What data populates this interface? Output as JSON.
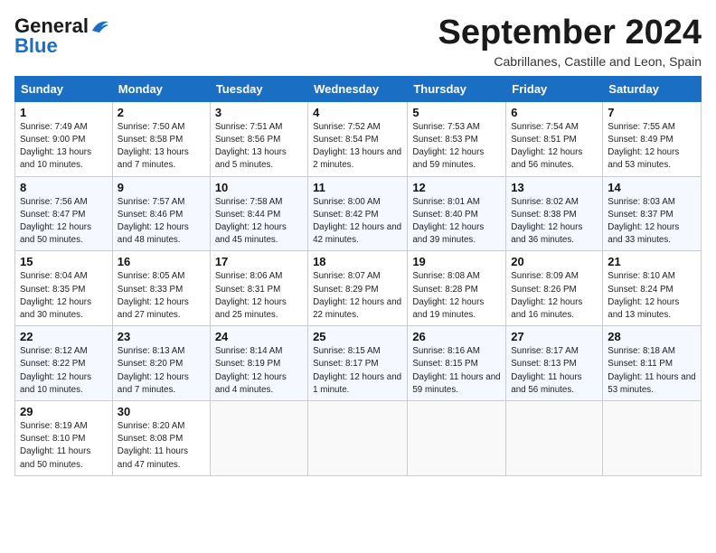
{
  "header": {
    "logo_general": "General",
    "logo_blue": "Blue",
    "month_title": "September 2024",
    "location": "Cabrillanes, Castille and Leon, Spain"
  },
  "weekdays": [
    "Sunday",
    "Monday",
    "Tuesday",
    "Wednesday",
    "Thursday",
    "Friday",
    "Saturday"
  ],
  "weeks": [
    [
      {
        "day": "1",
        "sunrise": "7:49 AM",
        "sunset": "9:00 PM",
        "daylight": "13 hours and 10 minutes."
      },
      {
        "day": "2",
        "sunrise": "7:50 AM",
        "sunset": "8:58 PM",
        "daylight": "13 hours and 7 minutes."
      },
      {
        "day": "3",
        "sunrise": "7:51 AM",
        "sunset": "8:56 PM",
        "daylight": "13 hours and 5 minutes."
      },
      {
        "day": "4",
        "sunrise": "7:52 AM",
        "sunset": "8:54 PM",
        "daylight": "13 hours and 2 minutes."
      },
      {
        "day": "5",
        "sunrise": "7:53 AM",
        "sunset": "8:53 PM",
        "daylight": "12 hours and 59 minutes."
      },
      {
        "day": "6",
        "sunrise": "7:54 AM",
        "sunset": "8:51 PM",
        "daylight": "12 hours and 56 minutes."
      },
      {
        "day": "7",
        "sunrise": "7:55 AM",
        "sunset": "8:49 PM",
        "daylight": "12 hours and 53 minutes."
      }
    ],
    [
      {
        "day": "8",
        "sunrise": "7:56 AM",
        "sunset": "8:47 PM",
        "daylight": "12 hours and 50 minutes."
      },
      {
        "day": "9",
        "sunrise": "7:57 AM",
        "sunset": "8:46 PM",
        "daylight": "12 hours and 48 minutes."
      },
      {
        "day": "10",
        "sunrise": "7:58 AM",
        "sunset": "8:44 PM",
        "daylight": "12 hours and 45 minutes."
      },
      {
        "day": "11",
        "sunrise": "8:00 AM",
        "sunset": "8:42 PM",
        "daylight": "12 hours and 42 minutes."
      },
      {
        "day": "12",
        "sunrise": "8:01 AM",
        "sunset": "8:40 PM",
        "daylight": "12 hours and 39 minutes."
      },
      {
        "day": "13",
        "sunrise": "8:02 AM",
        "sunset": "8:38 PM",
        "daylight": "12 hours and 36 minutes."
      },
      {
        "day": "14",
        "sunrise": "8:03 AM",
        "sunset": "8:37 PM",
        "daylight": "12 hours and 33 minutes."
      }
    ],
    [
      {
        "day": "15",
        "sunrise": "8:04 AM",
        "sunset": "8:35 PM",
        "daylight": "12 hours and 30 minutes."
      },
      {
        "day": "16",
        "sunrise": "8:05 AM",
        "sunset": "8:33 PM",
        "daylight": "12 hours and 27 minutes."
      },
      {
        "day": "17",
        "sunrise": "8:06 AM",
        "sunset": "8:31 PM",
        "daylight": "12 hours and 25 minutes."
      },
      {
        "day": "18",
        "sunrise": "8:07 AM",
        "sunset": "8:29 PM",
        "daylight": "12 hours and 22 minutes."
      },
      {
        "day": "19",
        "sunrise": "8:08 AM",
        "sunset": "8:28 PM",
        "daylight": "12 hours and 19 minutes."
      },
      {
        "day": "20",
        "sunrise": "8:09 AM",
        "sunset": "8:26 PM",
        "daylight": "12 hours and 16 minutes."
      },
      {
        "day": "21",
        "sunrise": "8:10 AM",
        "sunset": "8:24 PM",
        "daylight": "12 hours and 13 minutes."
      }
    ],
    [
      {
        "day": "22",
        "sunrise": "8:12 AM",
        "sunset": "8:22 PM",
        "daylight": "12 hours and 10 minutes."
      },
      {
        "day": "23",
        "sunrise": "8:13 AM",
        "sunset": "8:20 PM",
        "daylight": "12 hours and 7 minutes."
      },
      {
        "day": "24",
        "sunrise": "8:14 AM",
        "sunset": "8:19 PM",
        "daylight": "12 hours and 4 minutes."
      },
      {
        "day": "25",
        "sunrise": "8:15 AM",
        "sunset": "8:17 PM",
        "daylight": "12 hours and 1 minute."
      },
      {
        "day": "26",
        "sunrise": "8:16 AM",
        "sunset": "8:15 PM",
        "daylight": "11 hours and 59 minutes."
      },
      {
        "day": "27",
        "sunrise": "8:17 AM",
        "sunset": "8:13 PM",
        "daylight": "11 hours and 56 minutes."
      },
      {
        "day": "28",
        "sunrise": "8:18 AM",
        "sunset": "8:11 PM",
        "daylight": "11 hours and 53 minutes."
      }
    ],
    [
      {
        "day": "29",
        "sunrise": "8:19 AM",
        "sunset": "8:10 PM",
        "daylight": "11 hours and 50 minutes."
      },
      {
        "day": "30",
        "sunrise": "8:20 AM",
        "sunset": "8:08 PM",
        "daylight": "11 hours and 47 minutes."
      },
      null,
      null,
      null,
      null,
      null
    ]
  ]
}
